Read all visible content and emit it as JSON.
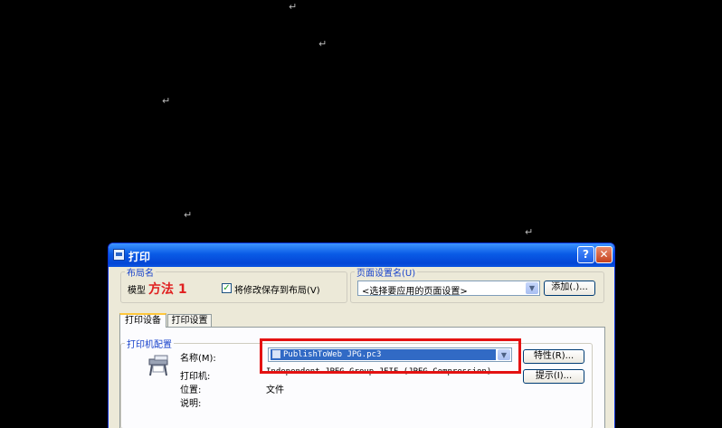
{
  "window": {
    "title": "打印",
    "help_label": "?",
    "close_label": "✕"
  },
  "layout_group": {
    "legend": "布局名",
    "layout_name": "模型",
    "annotation": "方法 1",
    "save_checkbox_label": "将修改保存到布局(V)",
    "save_checked": true
  },
  "page_setup_group": {
    "legend": "页面设置名(U)",
    "selected": "<选择要应用的页面设置>",
    "add_button": "添加(.)..."
  },
  "tabs": [
    {
      "label": "打印设备",
      "active": true
    },
    {
      "label": "打印设置",
      "active": false
    }
  ],
  "printer_group": {
    "legend": "打印机配置",
    "name_label": "名称(M):",
    "name_value": "PublishToWeb JPG.pc3",
    "properties_button": "特性(R)...",
    "printer_label": "打印机:",
    "printer_value": "Independent JPEG Group JFIF (JPEG Compression)",
    "hints_button": "提示(I)...",
    "location_label": "位置:",
    "location_value": "文件",
    "description_label": "说明:"
  },
  "colors": {
    "highlight": "#e41212",
    "title_bar": "#0a5be6"
  }
}
